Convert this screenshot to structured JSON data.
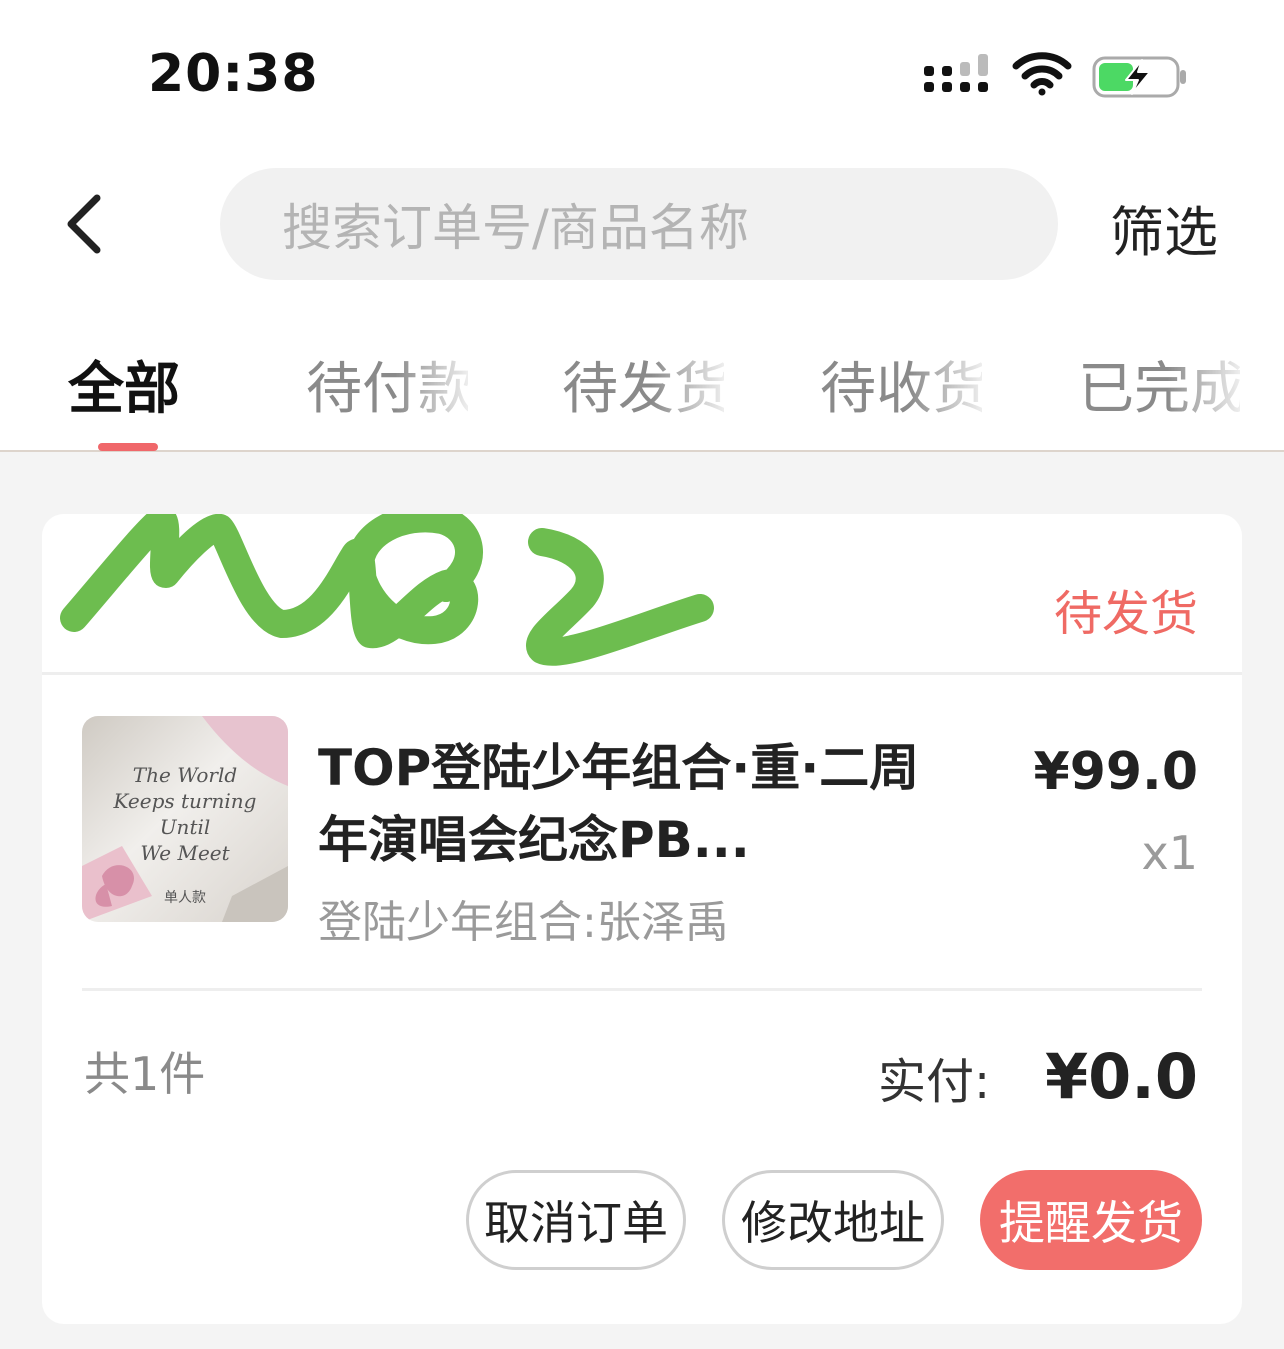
{
  "status_bar": {
    "time": "20:38"
  },
  "header": {
    "search_placeholder": "搜索订单号/商品名称",
    "filter_label": "筛选"
  },
  "tabs": [
    {
      "label": "全部",
      "active": true
    },
    {
      "label": "待付款",
      "active": false
    },
    {
      "label": "待发货",
      "active": false
    },
    {
      "label": "待收货",
      "active": false
    },
    {
      "label": "已完成",
      "active": false
    }
  ],
  "order": {
    "status": "待发货",
    "product": {
      "name": "TOP登陆少年组合·重·二周年演唱会纪念PB...",
      "spec": "登陆少年组合:张泽禹",
      "price": "¥99.0",
      "quantity": "x1",
      "thumbnail_text": "The World Keeps turning Until We Meet",
      "thumbnail_caption": "单人款"
    },
    "item_count": "共1件",
    "paid_label": "实付:",
    "paid_amount": "¥0.0",
    "buttons": {
      "cancel": "取消订单",
      "modify_address": "修改地址",
      "remind_shipping": "提醒发货"
    }
  },
  "colors": {
    "accent": "#f26e6b",
    "status_text": "#ef6a64",
    "scribble": "#6dbd4f",
    "battery_fill": "#4cd964"
  }
}
